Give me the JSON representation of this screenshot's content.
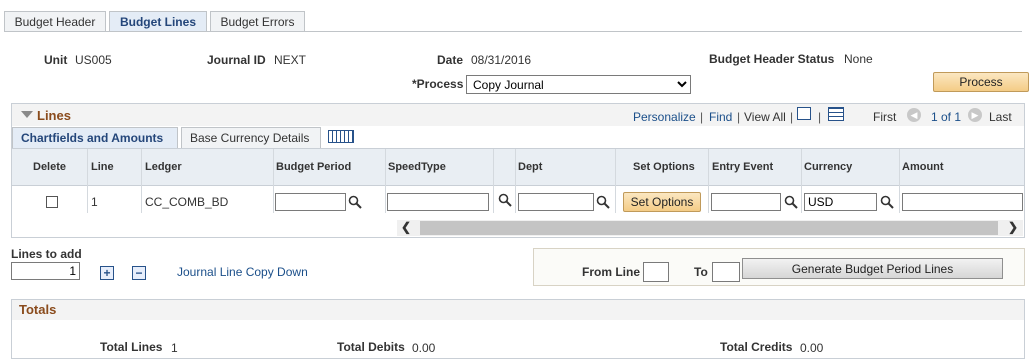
{
  "tabs": [
    {
      "label": "Budget Header"
    },
    {
      "label": "Budget Lines"
    },
    {
      "label": "Budget Errors"
    }
  ],
  "header": {
    "unit_label": "Unit",
    "unit_value": "US005",
    "journal_id_label": "Journal ID",
    "journal_id_value": "NEXT",
    "date_label": "Date",
    "date_value": "08/31/2016",
    "status_label": "Budget Header Status",
    "status_value": "None",
    "process_label": "*Process",
    "process_value": "Copy Journal",
    "process_button": "Process"
  },
  "lines": {
    "title": "Lines",
    "personalize": "Personalize",
    "find": "Find",
    "view_all": "View All",
    "pager_first": "First",
    "pager_range": "1 of 1",
    "pager_last": "Last",
    "subtabs": [
      "Chartfields and Amounts",
      "Base Currency Details"
    ],
    "columns": [
      "Delete",
      "Line",
      "Ledger",
      "Budget Period",
      "SpeedType",
      "Dept",
      "Set Options",
      "Entry Event",
      "Currency",
      "Amount"
    ],
    "row": {
      "line": "1",
      "ledger": "CC_COMB_BD",
      "budget_period": "",
      "speedtype": "",
      "dept": "",
      "set_options_label": "Set Options",
      "entry_event": "",
      "currency": "USD",
      "amount": ""
    }
  },
  "add_lines": {
    "label": "Lines to add",
    "value": "1",
    "copy_down": "Journal Line Copy Down"
  },
  "period_lines": {
    "from_label": "From Line",
    "to_label": "To",
    "from_value": "",
    "to_value": "",
    "generate_button": "Generate Budget Period Lines"
  },
  "totals": {
    "title": "Totals",
    "lines_label": "Total Lines",
    "lines_value": "1",
    "debits_label": "Total Debits",
    "debits_value": "0.00",
    "credits_label": "Total Credits",
    "credits_value": "0.00"
  },
  "colors": {
    "section_title": "#8a4b1c",
    "link": "#1b4f8a",
    "button_orange": "#f4cc86"
  }
}
